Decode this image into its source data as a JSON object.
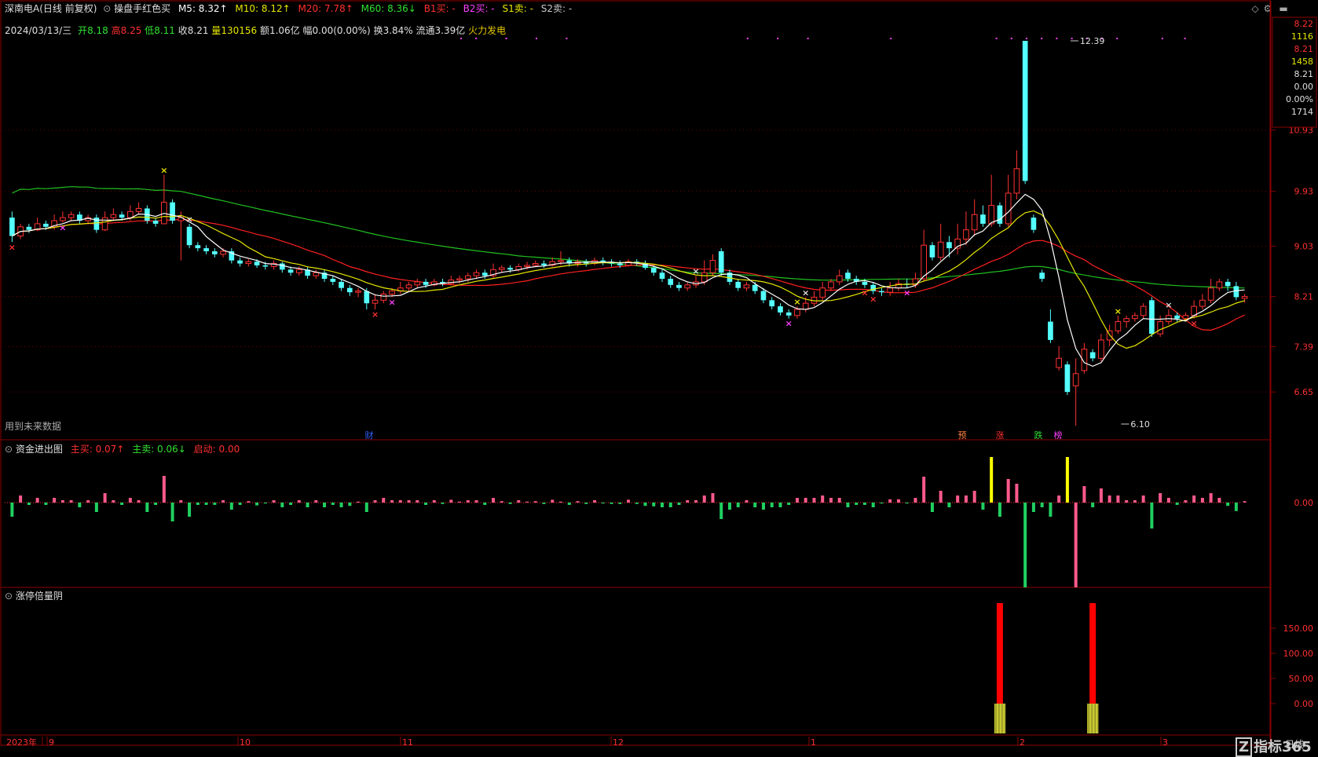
{
  "header": {
    "stock": "深南电A(日线 前复权)",
    "indicator": "操盘手红色买",
    "ma5": "M5: 8.32↑",
    "ma10": "M10: 8.12↑",
    "ma20": "M20: 7.78↑",
    "ma60": "M60: 8.36↓",
    "b1": "B1买: -",
    "b2": "B2买: -",
    "s1": "S1卖: -",
    "s2": "S2卖: -"
  },
  "info": {
    "date": "2024/03/13/三",
    "open_lbl": "开",
    "open": "8.18",
    "high_lbl": "高",
    "high": "8.25",
    "low_lbl": "低",
    "low": "8.11",
    "close_lbl": "收",
    "close": "8.21",
    "vol_lbl": "量",
    "vol": "130156",
    "amt": "额1.06亿",
    "chg": "幅0.00(0.00%)",
    "turn": "换3.84%",
    "float": "流通3.39亿",
    "concept": "火力发电"
  },
  "future_note": "用到未来数据",
  "price_axis": [
    "10.93",
    "9.93",
    "9.03",
    "8.21",
    "7.39",
    "6.65"
  ],
  "info_box": [
    "8.22",
    "1116",
    "8.21",
    "1458",
    "8.21",
    "0.00",
    "0.00%",
    "1714"
  ],
  "peak_label": "12.39",
  "trough_label": "6.10",
  "event_tags": [
    "财",
    "预",
    "涨",
    "跌",
    "榜"
  ],
  "panel2": {
    "title": "资金进出图",
    "buy": "主买: 0.07↑",
    "sell": "主卖: 0.06↓",
    "start": "启动: 0.00",
    "axis": "0.00"
  },
  "panel3": {
    "title": "涨停倍量阴",
    "axis": [
      "150.00",
      "100.00",
      "50.00",
      "0.00"
    ]
  },
  "time_axis": [
    "2023年",
    "9",
    "10",
    "11",
    "12",
    "1",
    "2",
    "3"
  ],
  "brand": "指标365",
  "period": "日线",
  "colors": {
    "up": "#ff3232",
    "down": "#54ffff",
    "ma5": "#ffffff",
    "ma10": "#e6e600",
    "ma20": "#ff2020",
    "ma60": "#20c020",
    "magenta": "#ff40ff"
  },
  "chart_data": {
    "type": "candlestick",
    "ylim": [
      6.1,
      12.39
    ],
    "candles": [
      [
        9.5,
        9.2,
        9.6,
        9.1
      ],
      [
        9.2,
        9.35,
        9.4,
        9.15
      ],
      [
        9.35,
        9.3,
        9.4,
        9.25
      ],
      [
        9.3,
        9.4,
        9.5,
        9.28
      ],
      [
        9.4,
        9.35,
        9.45,
        9.3
      ],
      [
        9.35,
        9.45,
        9.55,
        9.3
      ],
      [
        9.45,
        9.5,
        9.6,
        9.42
      ],
      [
        9.5,
        9.55,
        9.6,
        9.45
      ],
      [
        9.55,
        9.45,
        9.6,
        9.4
      ],
      [
        9.45,
        9.5,
        9.55,
        9.4
      ],
      [
        9.5,
        9.3,
        9.55,
        9.25
      ],
      [
        9.3,
        9.5,
        9.6,
        9.28
      ],
      [
        9.5,
        9.55,
        9.65,
        9.45
      ],
      [
        9.55,
        9.5,
        9.6,
        9.45
      ],
      [
        9.5,
        9.6,
        9.7,
        9.45
      ],
      [
        9.6,
        9.65,
        9.75,
        9.55
      ],
      [
        9.65,
        9.45,
        9.7,
        9.4
      ],
      [
        9.45,
        9.4,
        9.5,
        9.35
      ],
      [
        9.4,
        9.75,
        10.2,
        9.4
      ],
      [
        9.75,
        9.45,
        9.8,
        9.4
      ],
      [
        9.45,
        9.5,
        9.6,
        8.8
      ],
      [
        9.35,
        9.05,
        9.4,
        9.0
      ],
      [
        9.05,
        9.0,
        9.1,
        8.95
      ],
      [
        9.0,
        8.95,
        9.05,
        8.9
      ],
      [
        8.95,
        8.9,
        9.0,
        8.85
      ],
      [
        8.9,
        8.95,
        9.0,
        8.85
      ],
      [
        8.95,
        8.8,
        9.0,
        8.75
      ],
      [
        8.8,
        8.75,
        8.85,
        8.7
      ],
      [
        8.75,
        8.78,
        8.82,
        8.7
      ],
      [
        8.78,
        8.72,
        8.82,
        8.68
      ],
      [
        8.72,
        8.7,
        8.78,
        8.65
      ],
      [
        8.7,
        8.75,
        8.8,
        8.65
      ],
      [
        8.75,
        8.65,
        8.78,
        8.6
      ],
      [
        8.65,
        8.6,
        8.7,
        8.55
      ],
      [
        8.6,
        8.65,
        8.7,
        8.55
      ],
      [
        8.65,
        8.55,
        8.7,
        8.5
      ],
      [
        8.55,
        8.6,
        8.65,
        8.5
      ],
      [
        8.6,
        8.5,
        8.65,
        8.45
      ],
      [
        8.5,
        8.45,
        8.55,
        8.4
      ],
      [
        8.45,
        8.35,
        8.5,
        8.3
      ],
      [
        8.35,
        8.28,
        8.4,
        8.22
      ],
      [
        8.28,
        8.3,
        8.35,
        8.2
      ],
      [
        8.3,
        8.1,
        8.35,
        8.0
      ],
      [
        8.1,
        8.15,
        8.25,
        8.0
      ],
      [
        8.15,
        8.25,
        8.3,
        8.1
      ],
      [
        8.25,
        8.3,
        8.35,
        8.2
      ],
      [
        8.3,
        8.35,
        8.45,
        8.25
      ],
      [
        8.35,
        8.4,
        8.45,
        8.3
      ],
      [
        8.4,
        8.45,
        8.5,
        8.35
      ],
      [
        8.45,
        8.4,
        8.5,
        8.35
      ],
      [
        8.4,
        8.45,
        8.5,
        8.38
      ],
      [
        8.45,
        8.42,
        8.5,
        8.38
      ],
      [
        8.42,
        8.48,
        8.55,
        8.4
      ],
      [
        8.48,
        8.5,
        8.55,
        8.42
      ],
      [
        8.5,
        8.55,
        8.6,
        8.45
      ],
      [
        8.55,
        8.6,
        8.65,
        8.5
      ],
      [
        8.6,
        8.55,
        8.65,
        8.5
      ],
      [
        8.55,
        8.65,
        8.75,
        8.5
      ],
      [
        8.65,
        8.68,
        8.72,
        8.6
      ],
      [
        8.68,
        8.65,
        8.72,
        8.6
      ],
      [
        8.65,
        8.7,
        8.75,
        8.62
      ],
      [
        8.7,
        8.72,
        8.78,
        8.65
      ],
      [
        8.72,
        8.75,
        8.8,
        8.7
      ],
      [
        8.75,
        8.72,
        8.8,
        8.68
      ],
      [
        8.72,
        8.78,
        8.85,
        8.7
      ],
      [
        8.78,
        8.8,
        8.95,
        8.72
      ],
      [
        8.8,
        8.75,
        8.85,
        8.7
      ],
      [
        8.75,
        8.78,
        8.82,
        8.7
      ],
      [
        8.78,
        8.75,
        8.82,
        8.7
      ],
      [
        8.75,
        8.8,
        8.85,
        8.72
      ],
      [
        8.8,
        8.78,
        8.85,
        8.72
      ],
      [
        8.78,
        8.75,
        8.82,
        8.7
      ],
      [
        8.75,
        8.72,
        8.8,
        8.68
      ],
      [
        8.72,
        8.78,
        8.82,
        8.7
      ],
      [
        8.78,
        8.75,
        8.82,
        8.72
      ],
      [
        8.75,
        8.68,
        8.8,
        8.65
      ],
      [
        8.68,
        8.6,
        8.72,
        8.55
      ],
      [
        8.6,
        8.5,
        8.65,
        8.45
      ],
      [
        8.5,
        8.4,
        8.55,
        8.35
      ],
      [
        8.4,
        8.35,
        8.45,
        8.3
      ],
      [
        8.35,
        8.4,
        8.45,
        8.3
      ],
      [
        8.4,
        8.45,
        8.55,
        8.35
      ],
      [
        8.45,
        8.6,
        8.8,
        8.4
      ],
      [
        8.6,
        8.8,
        8.9,
        8.55
      ],
      [
        8.95,
        8.6,
        9.0,
        8.55
      ],
      [
        8.6,
        8.45,
        8.65,
        8.4
      ],
      [
        8.45,
        8.35,
        8.5,
        8.3
      ],
      [
        8.35,
        8.4,
        8.45,
        8.3
      ],
      [
        8.4,
        8.3,
        8.45,
        8.25
      ],
      [
        8.3,
        8.15,
        8.35,
        8.1
      ],
      [
        8.15,
        8.05,
        8.2,
        8.0
      ],
      [
        8.05,
        7.95,
        8.1,
        7.9
      ],
      [
        7.95,
        7.9,
        8.0,
        7.85
      ],
      [
        7.9,
        8.0,
        8.05,
        7.85
      ],
      [
        8.0,
        8.1,
        8.2,
        7.95
      ],
      [
        8.1,
        8.2,
        8.3,
        8.05
      ],
      [
        8.2,
        8.35,
        8.45,
        8.15
      ],
      [
        8.35,
        8.45,
        8.5,
        8.3
      ],
      [
        8.45,
        8.55,
        8.65,
        8.4
      ],
      [
        8.6,
        8.5,
        8.65,
        8.45
      ],
      [
        8.5,
        8.45,
        8.55,
        8.4
      ],
      [
        8.45,
        8.4,
        8.5,
        8.35
      ],
      [
        8.4,
        8.3,
        8.45,
        8.25
      ],
      [
        8.3,
        8.28,
        8.35,
        8.22
      ],
      [
        8.28,
        8.35,
        8.45,
        8.22
      ],
      [
        8.35,
        8.42,
        8.5,
        8.3
      ],
      [
        8.42,
        8.4,
        8.5,
        8.35
      ],
      [
        8.4,
        8.5,
        8.6,
        8.35
      ],
      [
        8.5,
        9.05,
        9.3,
        8.45
      ],
      [
        9.05,
        8.85,
        9.1,
        8.8
      ],
      [
        8.85,
        9.1,
        9.4,
        8.8
      ],
      [
        9.1,
        9.0,
        9.2,
        8.85
      ],
      [
        9.0,
        9.15,
        9.4,
        8.9
      ],
      [
        9.15,
        9.3,
        9.6,
        9.05
      ],
      [
        9.3,
        9.55,
        9.8,
        9.2
      ],
      [
        9.55,
        9.4,
        9.7,
        9.35
      ],
      [
        9.4,
        9.7,
        10.2,
        9.35
      ],
      [
        9.7,
        9.4,
        9.75,
        9.35
      ],
      [
        9.4,
        9.9,
        10.2,
        9.35
      ],
      [
        9.9,
        10.3,
        10.6,
        9.8
      ],
      [
        12.39,
        10.1,
        12.39,
        10.05
      ],
      [
        9.5,
        9.3,
        9.55,
        9.25
      ],
      [
        8.6,
        8.5,
        8.65,
        8.45
      ],
      [
        7.8,
        7.5,
        8.0,
        7.45
      ],
      [
        7.05,
        7.2,
        7.4,
        7.0
      ],
      [
        7.1,
        6.65,
        7.15,
        6.6
      ],
      [
        6.75,
        6.95,
        7.2,
        6.1
      ],
      [
        7.0,
        7.35,
        7.45,
        6.95
      ],
      [
        7.3,
        7.2,
        7.35,
        7.15
      ],
      [
        7.2,
        7.5,
        7.6,
        7.15
      ],
      [
        7.5,
        7.65,
        7.75,
        7.4
      ],
      [
        7.65,
        7.8,
        7.9,
        7.6
      ],
      [
        7.8,
        7.85,
        7.9,
        7.7
      ],
      [
        7.85,
        7.9,
        7.95,
        7.8
      ],
      [
        7.9,
        8.05,
        8.1,
        7.85
      ],
      [
        8.15,
        7.6,
        8.2,
        7.55
      ],
      [
        7.6,
        7.8,
        7.9,
        7.55
      ],
      [
        7.8,
        7.9,
        8.0,
        7.75
      ],
      [
        7.9,
        7.85,
        7.95,
        7.8
      ],
      [
        7.85,
        7.9,
        7.95,
        7.8
      ],
      [
        7.9,
        8.05,
        8.15,
        7.85
      ],
      [
        8.05,
        8.15,
        8.25,
        8.0
      ],
      [
        8.15,
        8.35,
        8.5,
        8.1
      ],
      [
        8.35,
        8.45,
        8.5,
        8.3
      ],
      [
        8.45,
        8.38,
        8.5,
        8.3
      ],
      [
        8.38,
        8.2,
        8.45,
        8.15
      ],
      [
        8.18,
        8.21,
        8.25,
        8.11
      ]
    ]
  }
}
